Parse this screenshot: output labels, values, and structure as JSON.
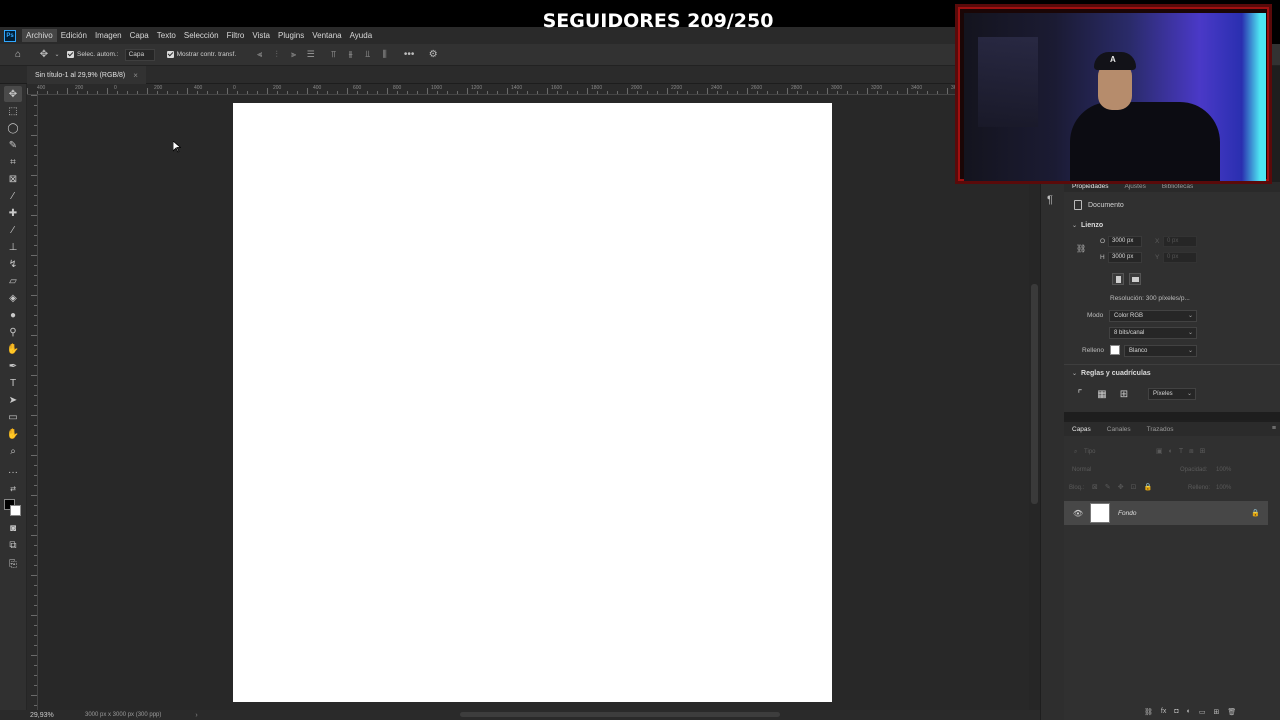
{
  "overlay": {
    "title": "SEGUIDORES 209/250"
  },
  "menubar": {
    "logo": "Ps",
    "items": [
      "Archivo",
      "Edición",
      "Imagen",
      "Capa",
      "Texto",
      "Selección",
      "Filtro",
      "Vista",
      "Plugins",
      "Ventana",
      "Ayuda"
    ]
  },
  "options": {
    "auto_select_label": "Selec. autom.:",
    "auto_select_target": "Capa",
    "show_transform_label": "Mostrar contr. transf.",
    "more": "•••"
  },
  "document_tab": {
    "title": "Sin título-1 al 29,9% (RGB/8)",
    "close": "×"
  },
  "ruler": {
    "top_labels": [
      "400",
      "200",
      "0",
      "200",
      "400",
      "600",
      "800",
      "1000",
      "1200",
      "1400",
      "1600",
      "1800",
      "2000",
      "2200",
      "2400",
      "2600",
      "2800",
      "3000",
      "3200",
      "3400",
      "3600"
    ]
  },
  "status": {
    "zoom": "29,93%",
    "doc_info": "3000 px x 3000 px (300 ppp)",
    "arrow": "›"
  },
  "properties": {
    "tabs": [
      "Propiedades",
      "Ajustes",
      "Bibliotecas"
    ],
    "doc_label": "Documento",
    "canvas_section": "Lienzo",
    "width_label": "O",
    "width_value": "3000 px",
    "height_label": "H",
    "height_value": "3000 px",
    "x_label": "X",
    "x_value": "0 px",
    "y_label": "Y",
    "y_value": "0 px",
    "resolution": "Resolución: 300 píxeles/p...",
    "mode_label": "Modo",
    "mode_value": "Color RGB",
    "bits_value": "8 bits/canal",
    "fill_label": "Relleno",
    "fill_value": "Blanco",
    "rulers_section": "Reglas y cuadrículas",
    "units_value": "Píxeles"
  },
  "layers": {
    "tabs": [
      "Capas",
      "Canales",
      "Trazados"
    ],
    "search_placeholder": "Tipo",
    "blend_mode": "Normal",
    "opacity_label": "Opacidad:",
    "opacity_value": "100%",
    "lock_label": "Bloq.:",
    "fill_label": "Relleno:",
    "fill_value": "100%",
    "items": [
      {
        "name": "Fondo",
        "visible": true,
        "locked": true
      }
    ]
  },
  "colors": {
    "accent": "#31a8ff",
    "canvas": "#ffffff",
    "workspace": "#282828"
  }
}
